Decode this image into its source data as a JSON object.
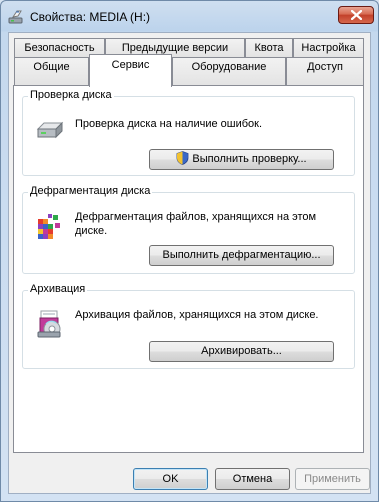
{
  "window": {
    "title": "Свойства: MEDIA (H:)"
  },
  "tabs": {
    "row1": [
      "Безопасность",
      "Предыдущие версии",
      "Квота",
      "Настройка"
    ],
    "row2": [
      "Общие",
      "Сервис",
      "Оборудование",
      "Доступ"
    ],
    "active": "Сервис"
  },
  "groups": {
    "check": {
      "title": "Проверка диска",
      "description": "Проверка диска на наличие ошибок.",
      "button": "Выполнить проверку..."
    },
    "defrag": {
      "title": "Дефрагментация диска",
      "description": "Дефрагментация файлов, хранящихся на этом диске.",
      "button": "Выполнить дефрагментацию..."
    },
    "backup": {
      "title": "Архивация",
      "description": "Архивация файлов, хранящихся на этом диске.",
      "button": "Архивировать..."
    }
  },
  "dialog_buttons": {
    "ok": "OK",
    "cancel": "Отмена",
    "apply": "Применить"
  },
  "icons": {
    "title": "drive-properties-icon",
    "close": "close-icon",
    "check": "hard-drive-icon",
    "defrag": "defrag-icon",
    "backup": "backup-icon",
    "uac": "uac-shield-icon"
  },
  "colors": {
    "close_button": "#c2402a",
    "window_frame": "#bcd3ec",
    "default_button_border": "#3c7fb1"
  }
}
